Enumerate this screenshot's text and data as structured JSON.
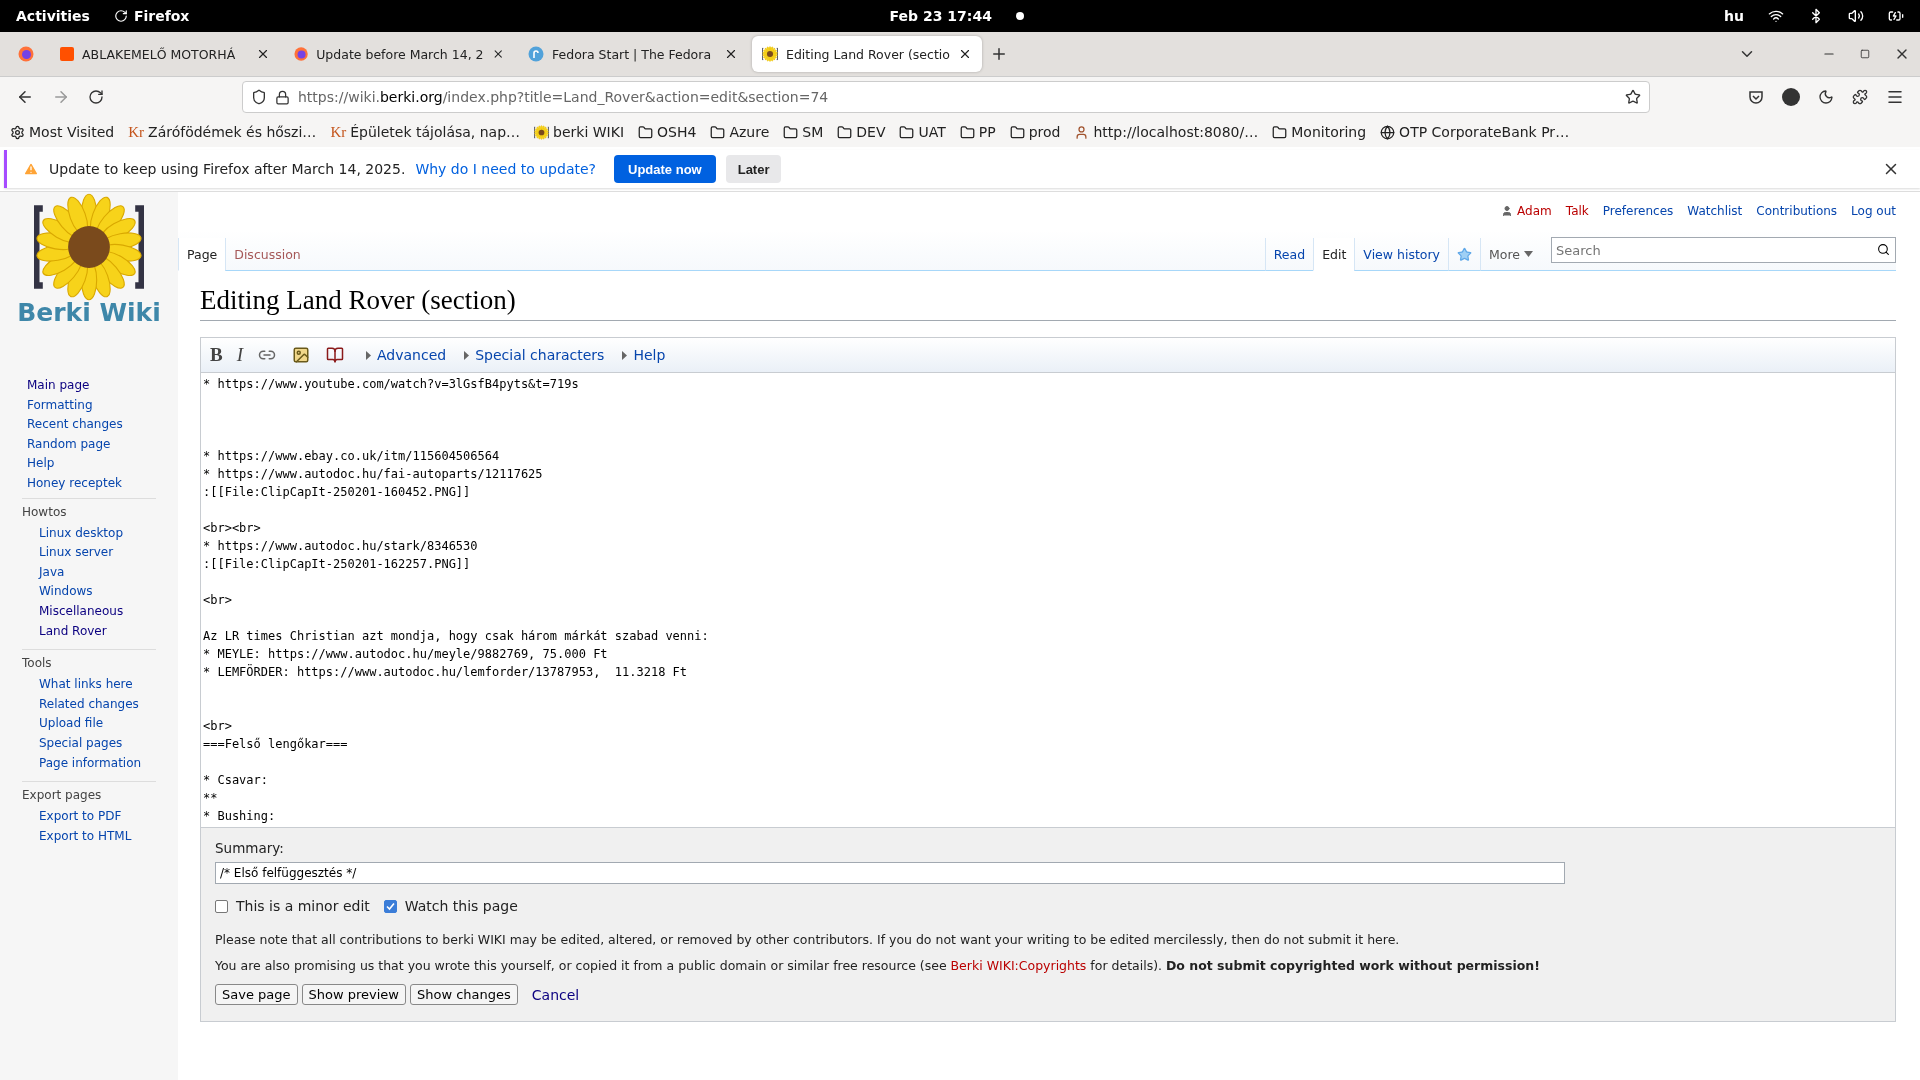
{
  "system_bar": {
    "activities": "Activities",
    "app": "Firefox",
    "clock": "Feb 23  17:44",
    "language": "hu"
  },
  "tabs": [
    {
      "title": "ABLAKEMELŐ MOTORHÁ",
      "kind": "shop",
      "selected": false
    },
    {
      "title": "Update before March 14, 2",
      "kind": "firefox",
      "selected": false
    },
    {
      "title": "Fedora Start | The Fedora",
      "kind": "fedora",
      "selected": false
    },
    {
      "title": "Editing Land Rover (sectio",
      "kind": "wiki",
      "selected": true
    }
  ],
  "address_bar": {
    "prefix": "https://wiki.",
    "domain": "berki.org",
    "path": "/index.php?title=Land_Rover&action=edit&section=74"
  },
  "bookmarks": [
    {
      "kind": "gear",
      "label": "Most Visited"
    },
    {
      "kind": "kr",
      "badge": "Kr",
      "label": "Zárófödémek és hőszi…"
    },
    {
      "kind": "kr",
      "badge": "Kr",
      "label": "Épületek tájolása, nap…"
    },
    {
      "kind": "wiki",
      "label": "berki WIKI"
    },
    {
      "kind": "folder",
      "label": "OSH4"
    },
    {
      "kind": "folder",
      "label": "Azure"
    },
    {
      "kind": "folder",
      "label": "SM"
    },
    {
      "kind": "folder",
      "label": "DEV"
    },
    {
      "kind": "folder",
      "label": "UAT"
    },
    {
      "kind": "folder",
      "label": "PP"
    },
    {
      "kind": "folder",
      "label": "prod"
    },
    {
      "kind": "person",
      "label": "http://localhost:8080/…"
    },
    {
      "kind": "folder",
      "label": "Monitoring"
    },
    {
      "kind": "globe",
      "label": "OTP CorporateBank Pr…"
    }
  ],
  "notification": {
    "message": "Update to keep using Firefox after March 14, 2025.",
    "link": "Why do I need to update?",
    "primary": "Update now",
    "secondary": "Later"
  },
  "wiki": {
    "logo_text": "Berki Wiki",
    "personal": [
      {
        "label": "Adam",
        "exists": false,
        "user": true
      },
      {
        "label": "Talk",
        "exists": false,
        "user": false
      },
      {
        "label": "Preferences",
        "exists": true,
        "user": false
      },
      {
        "label": "Watchlist",
        "exists": true,
        "user": false
      },
      {
        "label": "Contributions",
        "exists": true,
        "user": false
      },
      {
        "label": "Log out",
        "exists": true,
        "user": false
      }
    ],
    "left_tabs": [
      {
        "label": "Page",
        "selected": true,
        "exists": true
      },
      {
        "label": "Discussion",
        "selected": false,
        "exists": false
      }
    ],
    "right_tabs": [
      {
        "label": "Read",
        "selected": false
      },
      {
        "label": "Edit",
        "selected": true
      },
      {
        "label": "View history",
        "selected": false
      }
    ],
    "more": "More",
    "search_placeholder": "Search",
    "navigation": [
      {
        "label": "Main page",
        "visited": true
      },
      {
        "label": "Formatting",
        "visited": false
      },
      {
        "label": "Recent changes",
        "visited": false
      },
      {
        "label": "Random page",
        "visited": false
      },
      {
        "label": "Help",
        "visited": false
      },
      {
        "label": "Honey receptek",
        "visited": false
      }
    ],
    "portals": [
      {
        "heading": "Howtos",
        "items": [
          {
            "label": "Linux desktop",
            "visited": false
          },
          {
            "label": "Linux server",
            "visited": false
          },
          {
            "label": "Java",
            "visited": false
          },
          {
            "label": "Windows",
            "visited": false
          },
          {
            "label": "Miscellaneous",
            "visited": true
          },
          {
            "label": "Land Rover",
            "visited": true
          }
        ]
      },
      {
        "heading": "Tools",
        "items": [
          {
            "label": "What links here",
            "visited": false
          },
          {
            "label": "Related changes",
            "visited": false
          },
          {
            "label": "Upload file",
            "visited": false
          },
          {
            "label": "Special pages",
            "visited": false
          },
          {
            "label": "Page information",
            "visited": false
          }
        ]
      },
      {
        "heading": "Export pages",
        "items": [
          {
            "label": "Export to PDF",
            "visited": false
          },
          {
            "label": "Export to HTML",
            "visited": false
          }
        ]
      }
    ],
    "title": "Editing Land Rover (section)",
    "toolbar": {
      "bold": "B",
      "italic": "I",
      "sections": [
        "Advanced",
        "Special characters",
        "Help"
      ]
    },
    "editor_text": "* https://www.youtube.com/watch?v=3lGsfB4pyts&t=719s\n\n\n\n* https://www.ebay.co.uk/itm/115604506564\n* https://www.autodoc.hu/fai-autoparts/12117625\n:[[File:ClipCapIt-250201-160452.PNG]]\n\n<br><br>\n* https://www.autodoc.hu/stark/8346530\n:[[File:ClipCapIt-250201-162257.PNG]]\n\n<br>\n\nAz LR times Christian azt mondja, hogy csak három márkát szabad venni:\n* MEYLE: https://www.autodoc.hu/meyle/9882769, 75.000 Ft\n* LEMFÖRDER: https://www.autodoc.hu/lemforder/13787953,  11.3218 Ft\n\n\n<br>\n===Felső lengőkar===\n\n* Csavar:\n** \n* Bushing:",
    "summary_label": "Summary:",
    "summary_value": "/* Első felfüggesztés */",
    "checkboxes": [
      {
        "label": "This is a minor edit",
        "checked": false
      },
      {
        "label": "Watch this page",
        "checked": true
      }
    ],
    "notice_1": "Please note that all contributions to berki WIKI may be edited, altered, or removed by other contributors. If you do not want your writing to be edited mercilessly, then do not submit it here.",
    "notice_2": {
      "before": "You are also promising us that you wrote this yourself, or copied it from a public domain or similar free resource (see ",
      "link": "Berki WIKI:Copyrights",
      "after": " for details). **Do not submit copyrighted work without permission!**"
    },
    "buttons": [
      "Save page",
      "Show preview",
      "Show changes"
    ],
    "cancel": "Cancel"
  }
}
